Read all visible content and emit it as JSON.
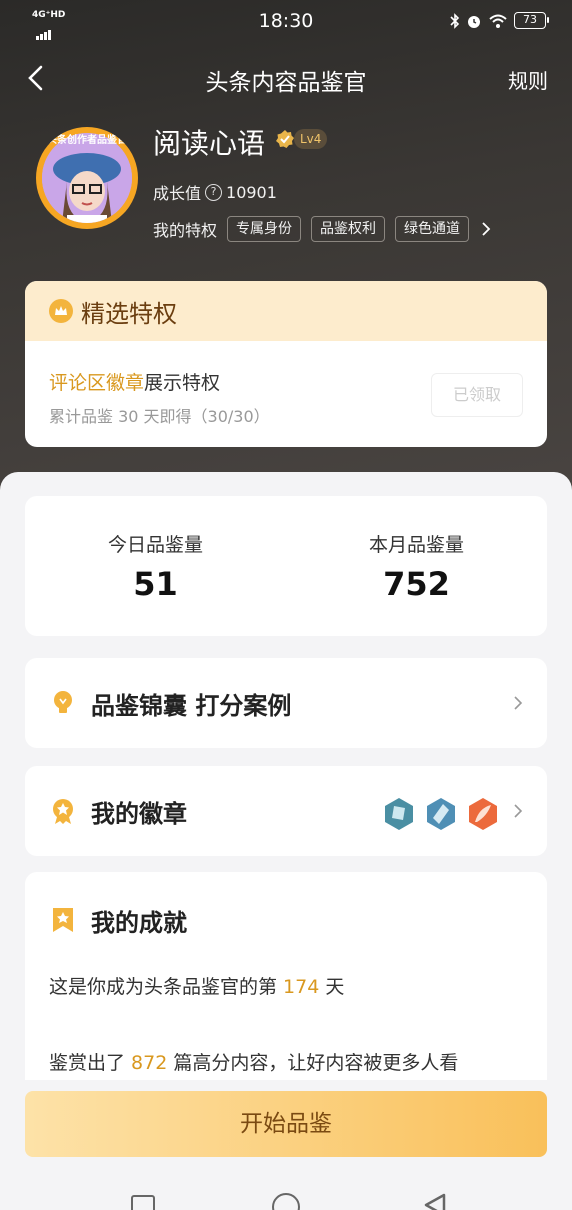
{
  "status_bar": {
    "network": "4G⁺HD",
    "time": "18:30",
    "battery": "73"
  },
  "nav": {
    "title": "头条内容品鉴官",
    "rules": "规则"
  },
  "profile": {
    "avatar_ring_text": "头条创作者品鉴官",
    "username": "阅读心语",
    "level": "Lv4",
    "growth_label": "成长值",
    "growth_value": "10901",
    "privileges_label": "我的特权",
    "tags": [
      "专属身份",
      "品鉴权利",
      "绿色通道"
    ]
  },
  "privilege_card": {
    "title": "精选特权",
    "highlight": "评论区徽章",
    "line1_rest": "展示特权",
    "line2": "累计品鉴 30 天即得（30/30）",
    "button": "已领取"
  },
  "stats": {
    "today_label": "今日品鉴量",
    "today_value": "51",
    "month_label": "本月品鉴量",
    "month_value": "752"
  },
  "tips": {
    "title": "品鉴锦囊 打分案例"
  },
  "badges": {
    "title": "我的徽章"
  },
  "achievements": {
    "title": "我的成就",
    "l1_pre": "这是你成为头条品鉴官的第 ",
    "l1_num": "174",
    "l1_post": " 天",
    "l2_pre": "鉴赏出了 ",
    "l2_num": "872",
    "l2_post": " 篇高分内容，让好内容被更多人看"
  },
  "cta": {
    "label": "开始品鉴"
  },
  "colors": {
    "accent": "#d9981f",
    "cta_start": "#fde2a8",
    "cta_end": "#f9c05a",
    "header_bg": "#3a3734"
  }
}
